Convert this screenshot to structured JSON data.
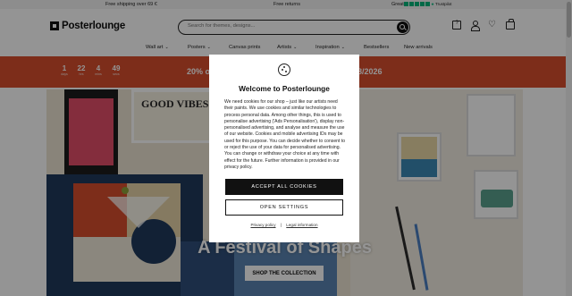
{
  "topbar": {
    "shipping": "Free shipping over 69 €",
    "returns": "Free returns",
    "rating_label": "Great",
    "trustpilot": "Trustpilot"
  },
  "header": {
    "logo": "Posterlounge",
    "search_placeholder": "Search for themes, designs..."
  },
  "nav": {
    "items": [
      {
        "label": "Wall art",
        "has_dropdown": true
      },
      {
        "label": "Posters",
        "has_dropdown": true
      },
      {
        "label": "Canvas prints",
        "has_dropdown": false
      },
      {
        "label": "Artists",
        "has_dropdown": true
      },
      {
        "label": "Inspiration",
        "has_dropdown": true
      },
      {
        "label": "Bestsellers",
        "has_dropdown": false
      },
      {
        "label": "New arrivals",
        "has_dropdown": false
      }
    ],
    "chevron": "⌄"
  },
  "promo": {
    "countdown": [
      {
        "value": "1",
        "label": "days"
      },
      {
        "value": "22",
        "label": "hrs"
      },
      {
        "value": "4",
        "label": "mins"
      },
      {
        "value": "49",
        "label": "secs"
      }
    ],
    "text_left": "20% of",
    "text_right": "8/2026",
    "background": "#d84f2e"
  },
  "hero": {
    "title": "A Festival of Shapes",
    "button": "SHOP THE COLLECTION",
    "artwork_text": "GOOD VIBES"
  },
  "cookie_modal": {
    "title": "Welcome to Posterlounge",
    "body": "We need cookies for our shop – just like our artists need their paints. We use cookies and similar technologies to process personal data. Among other things, this is used to personalise advertising ('Ads Personalisation'), display non-personalised advertising, and analyse and measure the use of our website. Cookies and mobile advertising IDs may be used for this purpose. You can decide whether to consent to or reject the use of your data for personalised advertising. You can change or withdraw your choice at any time with effect for the future. Further information is provided in our privacy policy.",
    "accept_button": "ACCEPT ALL COOKIES",
    "settings_button": "OPEN SETTINGS",
    "privacy_link": "Privacy policy",
    "separator": "|",
    "legal_link": "Legal information"
  },
  "colors": {
    "trustpilot_green": "#00b67a",
    "promo_orange": "#d84f2e"
  }
}
